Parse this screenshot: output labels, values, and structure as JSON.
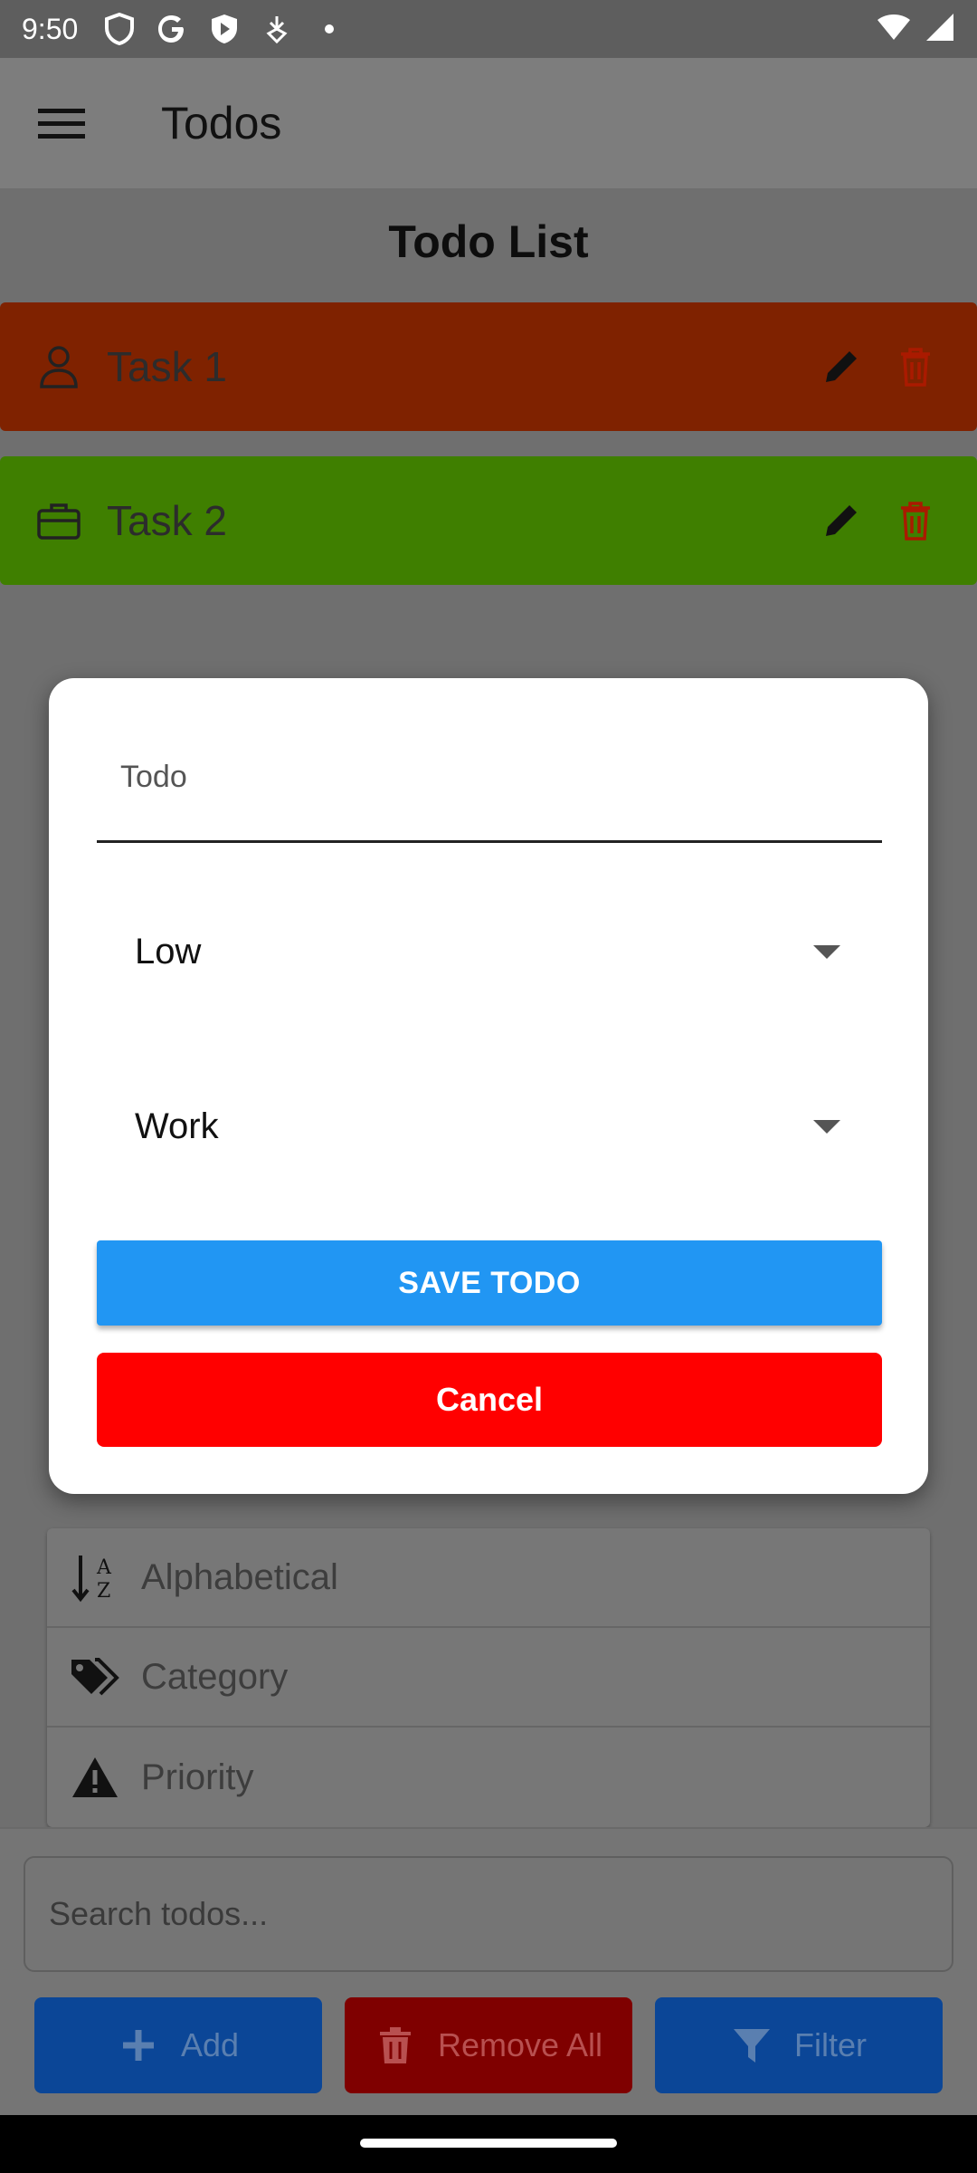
{
  "status_bar": {
    "time": "9:50"
  },
  "app_bar": {
    "title": "Todos",
    "menu_icon": "hamburger-menu-icon"
  },
  "list": {
    "title": "Todo List",
    "items": [
      {
        "label": "Task 1",
        "category_icon": "person-icon",
        "color": "#7f2200"
      },
      {
        "label": "Task 2",
        "category_icon": "briefcase-icon",
        "color": "#3f7f00"
      }
    ]
  },
  "sort_options": [
    {
      "label": "Alphabetical",
      "icon": "sort-alpha-icon"
    },
    {
      "label": "Category",
      "icon": "tags-icon"
    },
    {
      "label": "Priority",
      "icon": "warning-icon"
    }
  ],
  "search": {
    "placeholder": "Search todos..."
  },
  "buttons": {
    "add": "Add",
    "remove_all": "Remove All",
    "filter": "Filter"
  },
  "dialog": {
    "todo_placeholder": "Todo",
    "priority_value": "Low",
    "category_value": "Work",
    "save_label": "SAVE TODO",
    "cancel_label": "Cancel"
  },
  "colors": {
    "save": "#2196f3",
    "cancel": "#ff0000",
    "add": "#0b4697",
    "remove": "#7f0000"
  }
}
